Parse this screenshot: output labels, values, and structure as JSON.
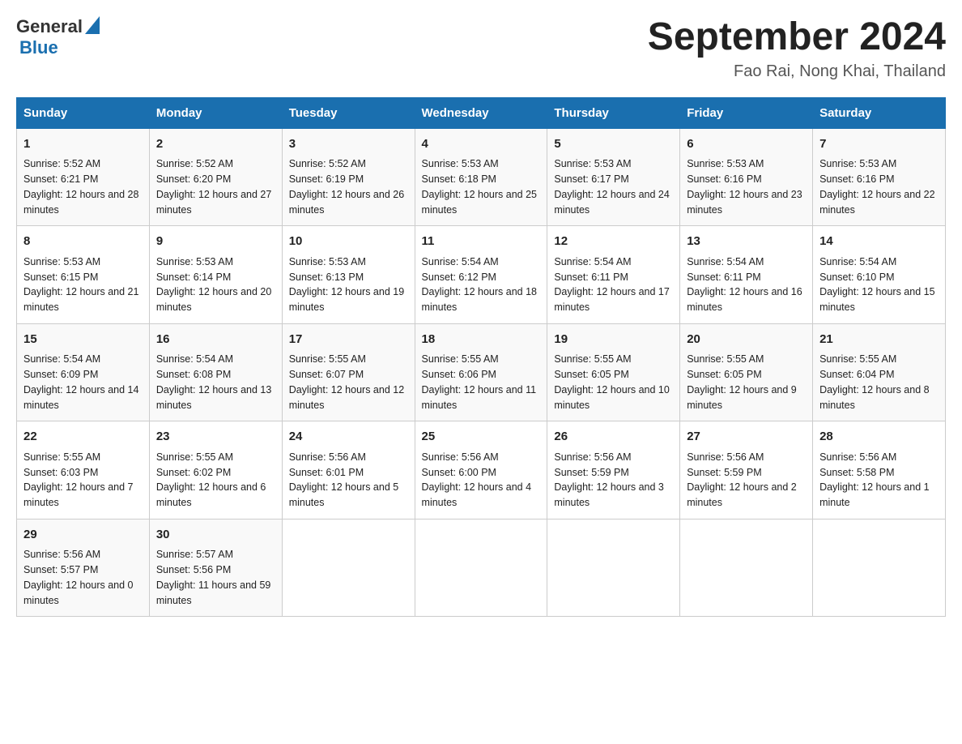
{
  "header": {
    "logo_general": "General",
    "logo_blue": "Blue",
    "month_year": "September 2024",
    "location": "Fao Rai, Nong Khai, Thailand"
  },
  "days_of_week": [
    "Sunday",
    "Monday",
    "Tuesday",
    "Wednesday",
    "Thursday",
    "Friday",
    "Saturday"
  ],
  "weeks": [
    [
      {
        "day": "1",
        "sunrise": "5:52 AM",
        "sunset": "6:21 PM",
        "daylight": "12 hours and 28 minutes."
      },
      {
        "day": "2",
        "sunrise": "5:52 AM",
        "sunset": "6:20 PM",
        "daylight": "12 hours and 27 minutes."
      },
      {
        "day": "3",
        "sunrise": "5:52 AM",
        "sunset": "6:19 PM",
        "daylight": "12 hours and 26 minutes."
      },
      {
        "day": "4",
        "sunrise": "5:53 AM",
        "sunset": "6:18 PM",
        "daylight": "12 hours and 25 minutes."
      },
      {
        "day": "5",
        "sunrise": "5:53 AM",
        "sunset": "6:17 PM",
        "daylight": "12 hours and 24 minutes."
      },
      {
        "day": "6",
        "sunrise": "5:53 AM",
        "sunset": "6:16 PM",
        "daylight": "12 hours and 23 minutes."
      },
      {
        "day": "7",
        "sunrise": "5:53 AM",
        "sunset": "6:16 PM",
        "daylight": "12 hours and 22 minutes."
      }
    ],
    [
      {
        "day": "8",
        "sunrise": "5:53 AM",
        "sunset": "6:15 PM",
        "daylight": "12 hours and 21 minutes."
      },
      {
        "day": "9",
        "sunrise": "5:53 AM",
        "sunset": "6:14 PM",
        "daylight": "12 hours and 20 minutes."
      },
      {
        "day": "10",
        "sunrise": "5:53 AM",
        "sunset": "6:13 PM",
        "daylight": "12 hours and 19 minutes."
      },
      {
        "day": "11",
        "sunrise": "5:54 AM",
        "sunset": "6:12 PM",
        "daylight": "12 hours and 18 minutes."
      },
      {
        "day": "12",
        "sunrise": "5:54 AM",
        "sunset": "6:11 PM",
        "daylight": "12 hours and 17 minutes."
      },
      {
        "day": "13",
        "sunrise": "5:54 AM",
        "sunset": "6:11 PM",
        "daylight": "12 hours and 16 minutes."
      },
      {
        "day": "14",
        "sunrise": "5:54 AM",
        "sunset": "6:10 PM",
        "daylight": "12 hours and 15 minutes."
      }
    ],
    [
      {
        "day": "15",
        "sunrise": "5:54 AM",
        "sunset": "6:09 PM",
        "daylight": "12 hours and 14 minutes."
      },
      {
        "day": "16",
        "sunrise": "5:54 AM",
        "sunset": "6:08 PM",
        "daylight": "12 hours and 13 minutes."
      },
      {
        "day": "17",
        "sunrise": "5:55 AM",
        "sunset": "6:07 PM",
        "daylight": "12 hours and 12 minutes."
      },
      {
        "day": "18",
        "sunrise": "5:55 AM",
        "sunset": "6:06 PM",
        "daylight": "12 hours and 11 minutes."
      },
      {
        "day": "19",
        "sunrise": "5:55 AM",
        "sunset": "6:05 PM",
        "daylight": "12 hours and 10 minutes."
      },
      {
        "day": "20",
        "sunrise": "5:55 AM",
        "sunset": "6:05 PM",
        "daylight": "12 hours and 9 minutes."
      },
      {
        "day": "21",
        "sunrise": "5:55 AM",
        "sunset": "6:04 PM",
        "daylight": "12 hours and 8 minutes."
      }
    ],
    [
      {
        "day": "22",
        "sunrise": "5:55 AM",
        "sunset": "6:03 PM",
        "daylight": "12 hours and 7 minutes."
      },
      {
        "day": "23",
        "sunrise": "5:55 AM",
        "sunset": "6:02 PM",
        "daylight": "12 hours and 6 minutes."
      },
      {
        "day": "24",
        "sunrise": "5:56 AM",
        "sunset": "6:01 PM",
        "daylight": "12 hours and 5 minutes."
      },
      {
        "day": "25",
        "sunrise": "5:56 AM",
        "sunset": "6:00 PM",
        "daylight": "12 hours and 4 minutes."
      },
      {
        "day": "26",
        "sunrise": "5:56 AM",
        "sunset": "5:59 PM",
        "daylight": "12 hours and 3 minutes."
      },
      {
        "day": "27",
        "sunrise": "5:56 AM",
        "sunset": "5:59 PM",
        "daylight": "12 hours and 2 minutes."
      },
      {
        "day": "28",
        "sunrise": "5:56 AM",
        "sunset": "5:58 PM",
        "daylight": "12 hours and 1 minute."
      }
    ],
    [
      {
        "day": "29",
        "sunrise": "5:56 AM",
        "sunset": "5:57 PM",
        "daylight": "12 hours and 0 minutes."
      },
      {
        "day": "30",
        "sunrise": "5:57 AM",
        "sunset": "5:56 PM",
        "daylight": "11 hours and 59 minutes."
      },
      null,
      null,
      null,
      null,
      null
    ]
  ],
  "labels": {
    "sunrise": "Sunrise:",
    "sunset": "Sunset:",
    "daylight": "Daylight:"
  }
}
